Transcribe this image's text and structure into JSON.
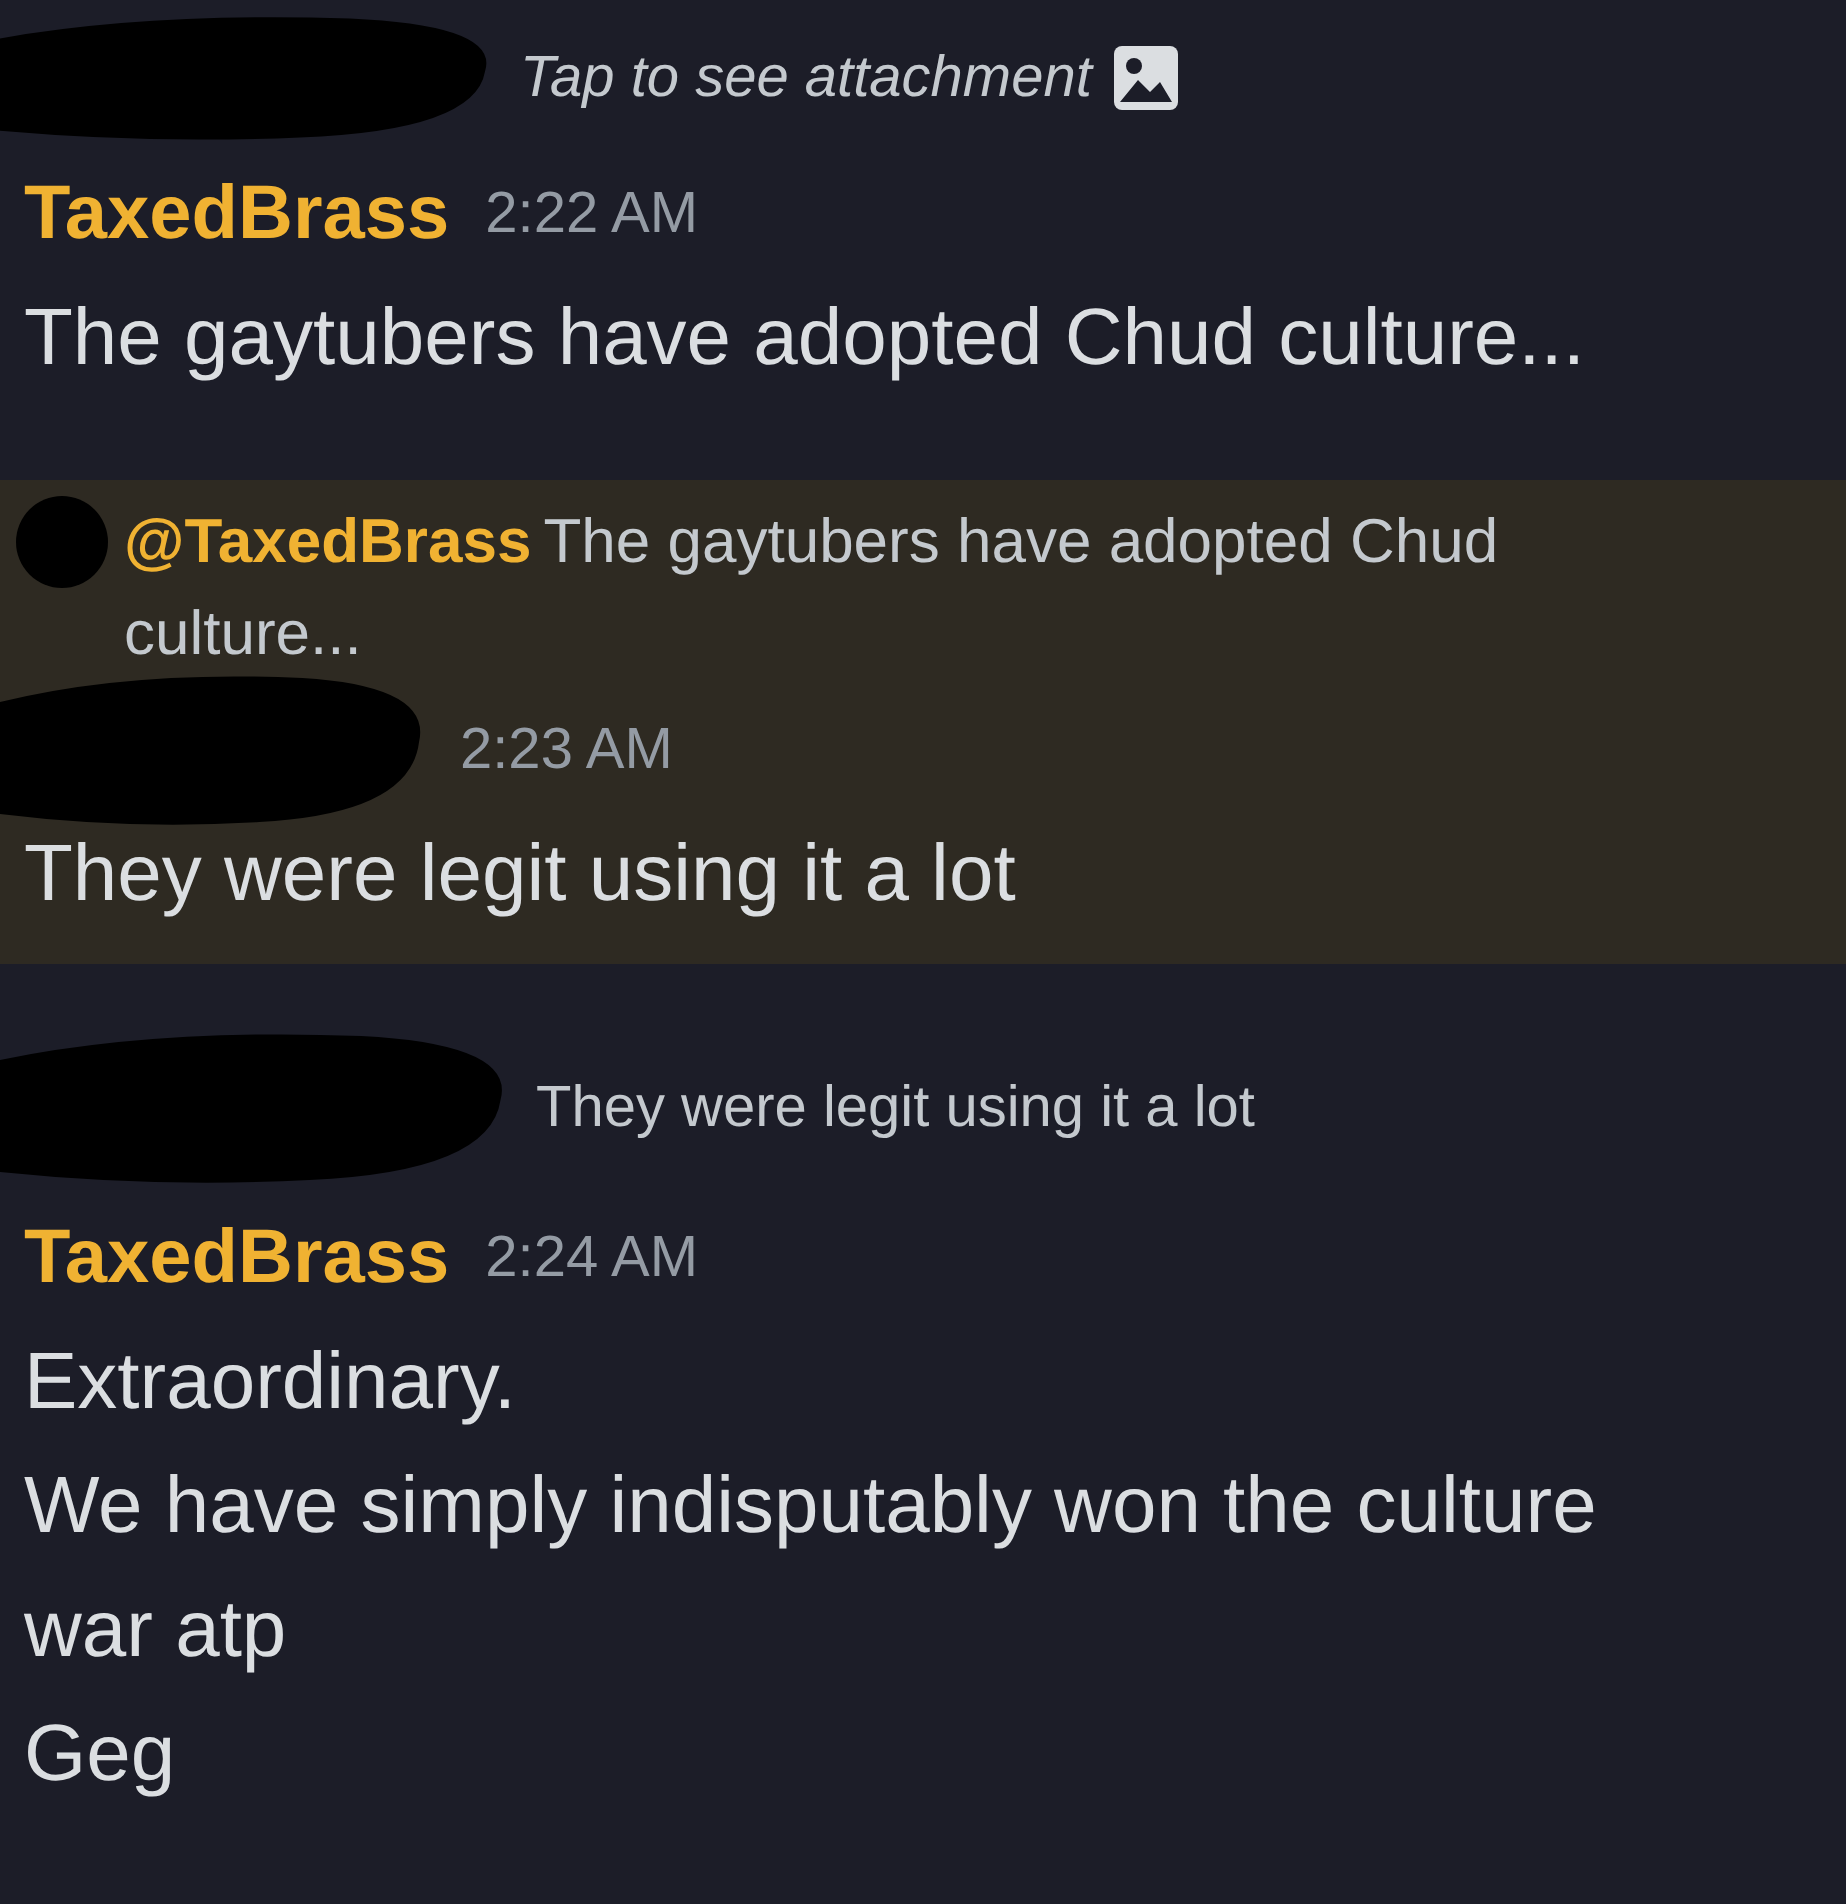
{
  "messages": [
    {
      "highlighted": false,
      "reply": {
        "kind": "attachment",
        "author_redacted": true,
        "text": "Tap to see attachment"
      },
      "author": {
        "redacted": false,
        "name": "TaxedBrass"
      },
      "time": "2:22 AM",
      "lines": [
        "The gaytubers have adopted Chud culture..."
      ]
    },
    {
      "highlighted": true,
      "reply": {
        "kind": "mention",
        "author_redacted": false,
        "mention": "@TaxedBrass",
        "text": "The gaytubers have adopted Chud culture..."
      },
      "author": {
        "redacted": true
      },
      "time": "2:23 AM",
      "lines": [
        "They were legit using it a lot"
      ]
    },
    {
      "highlighted": false,
      "reply": {
        "kind": "text",
        "author_redacted": true,
        "text": "They were legit using it a lot"
      },
      "author": {
        "redacted": false,
        "name": "TaxedBrass"
      },
      "time": "2:24 AM",
      "lines": [
        "Extraordinary.",
        "We have simply indisputably won the culture war atp",
        "Geg"
      ]
    }
  ]
}
